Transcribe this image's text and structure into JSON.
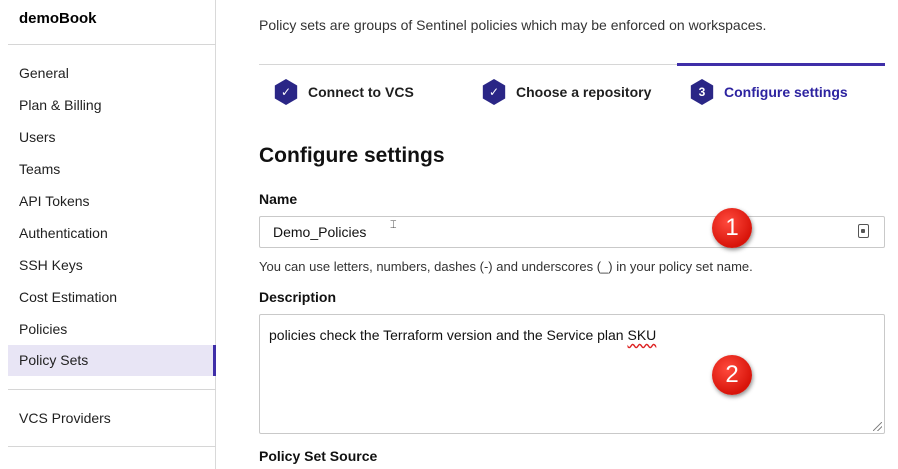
{
  "sidebar": {
    "org_name": "demoBook",
    "items": [
      {
        "label": "General"
      },
      {
        "label": "Plan & Billing"
      },
      {
        "label": "Users"
      },
      {
        "label": "Teams"
      },
      {
        "label": "API Tokens"
      },
      {
        "label": "Authentication"
      },
      {
        "label": "SSH Keys"
      },
      {
        "label": "Cost Estimation"
      },
      {
        "label": "Policies"
      },
      {
        "label": "Policy Sets",
        "active": true
      }
    ],
    "secondary_items": [
      {
        "label": "VCS Providers"
      }
    ]
  },
  "main": {
    "intro": "Policy sets are groups of Sentinel policies which may be enforced on workspaces.",
    "steps": [
      {
        "label": "Connect to VCS",
        "marker": "✓",
        "state": "complete"
      },
      {
        "label": "Choose a repository",
        "marker": "✓",
        "state": "complete"
      },
      {
        "label": "Configure settings",
        "marker": "3",
        "state": "current"
      }
    ],
    "section_title": "Configure settings",
    "name_field": {
      "label": "Name",
      "value": "Demo_Policies",
      "help": "You can use letters, numbers, dashes (-) and underscores (_) in your policy set name."
    },
    "description_field": {
      "label": "Description",
      "value_before": "policies check the Terraform version and the Service plan ",
      "value_flagged": "SKU"
    },
    "next_label": "Policy Set Source"
  },
  "annotations": [
    "1",
    "2"
  ],
  "colors": {
    "accent": "#3f2ea8",
    "step_icon": "#2a2686",
    "active_bg": "#e8e5f5",
    "badge": "#d8140a"
  }
}
